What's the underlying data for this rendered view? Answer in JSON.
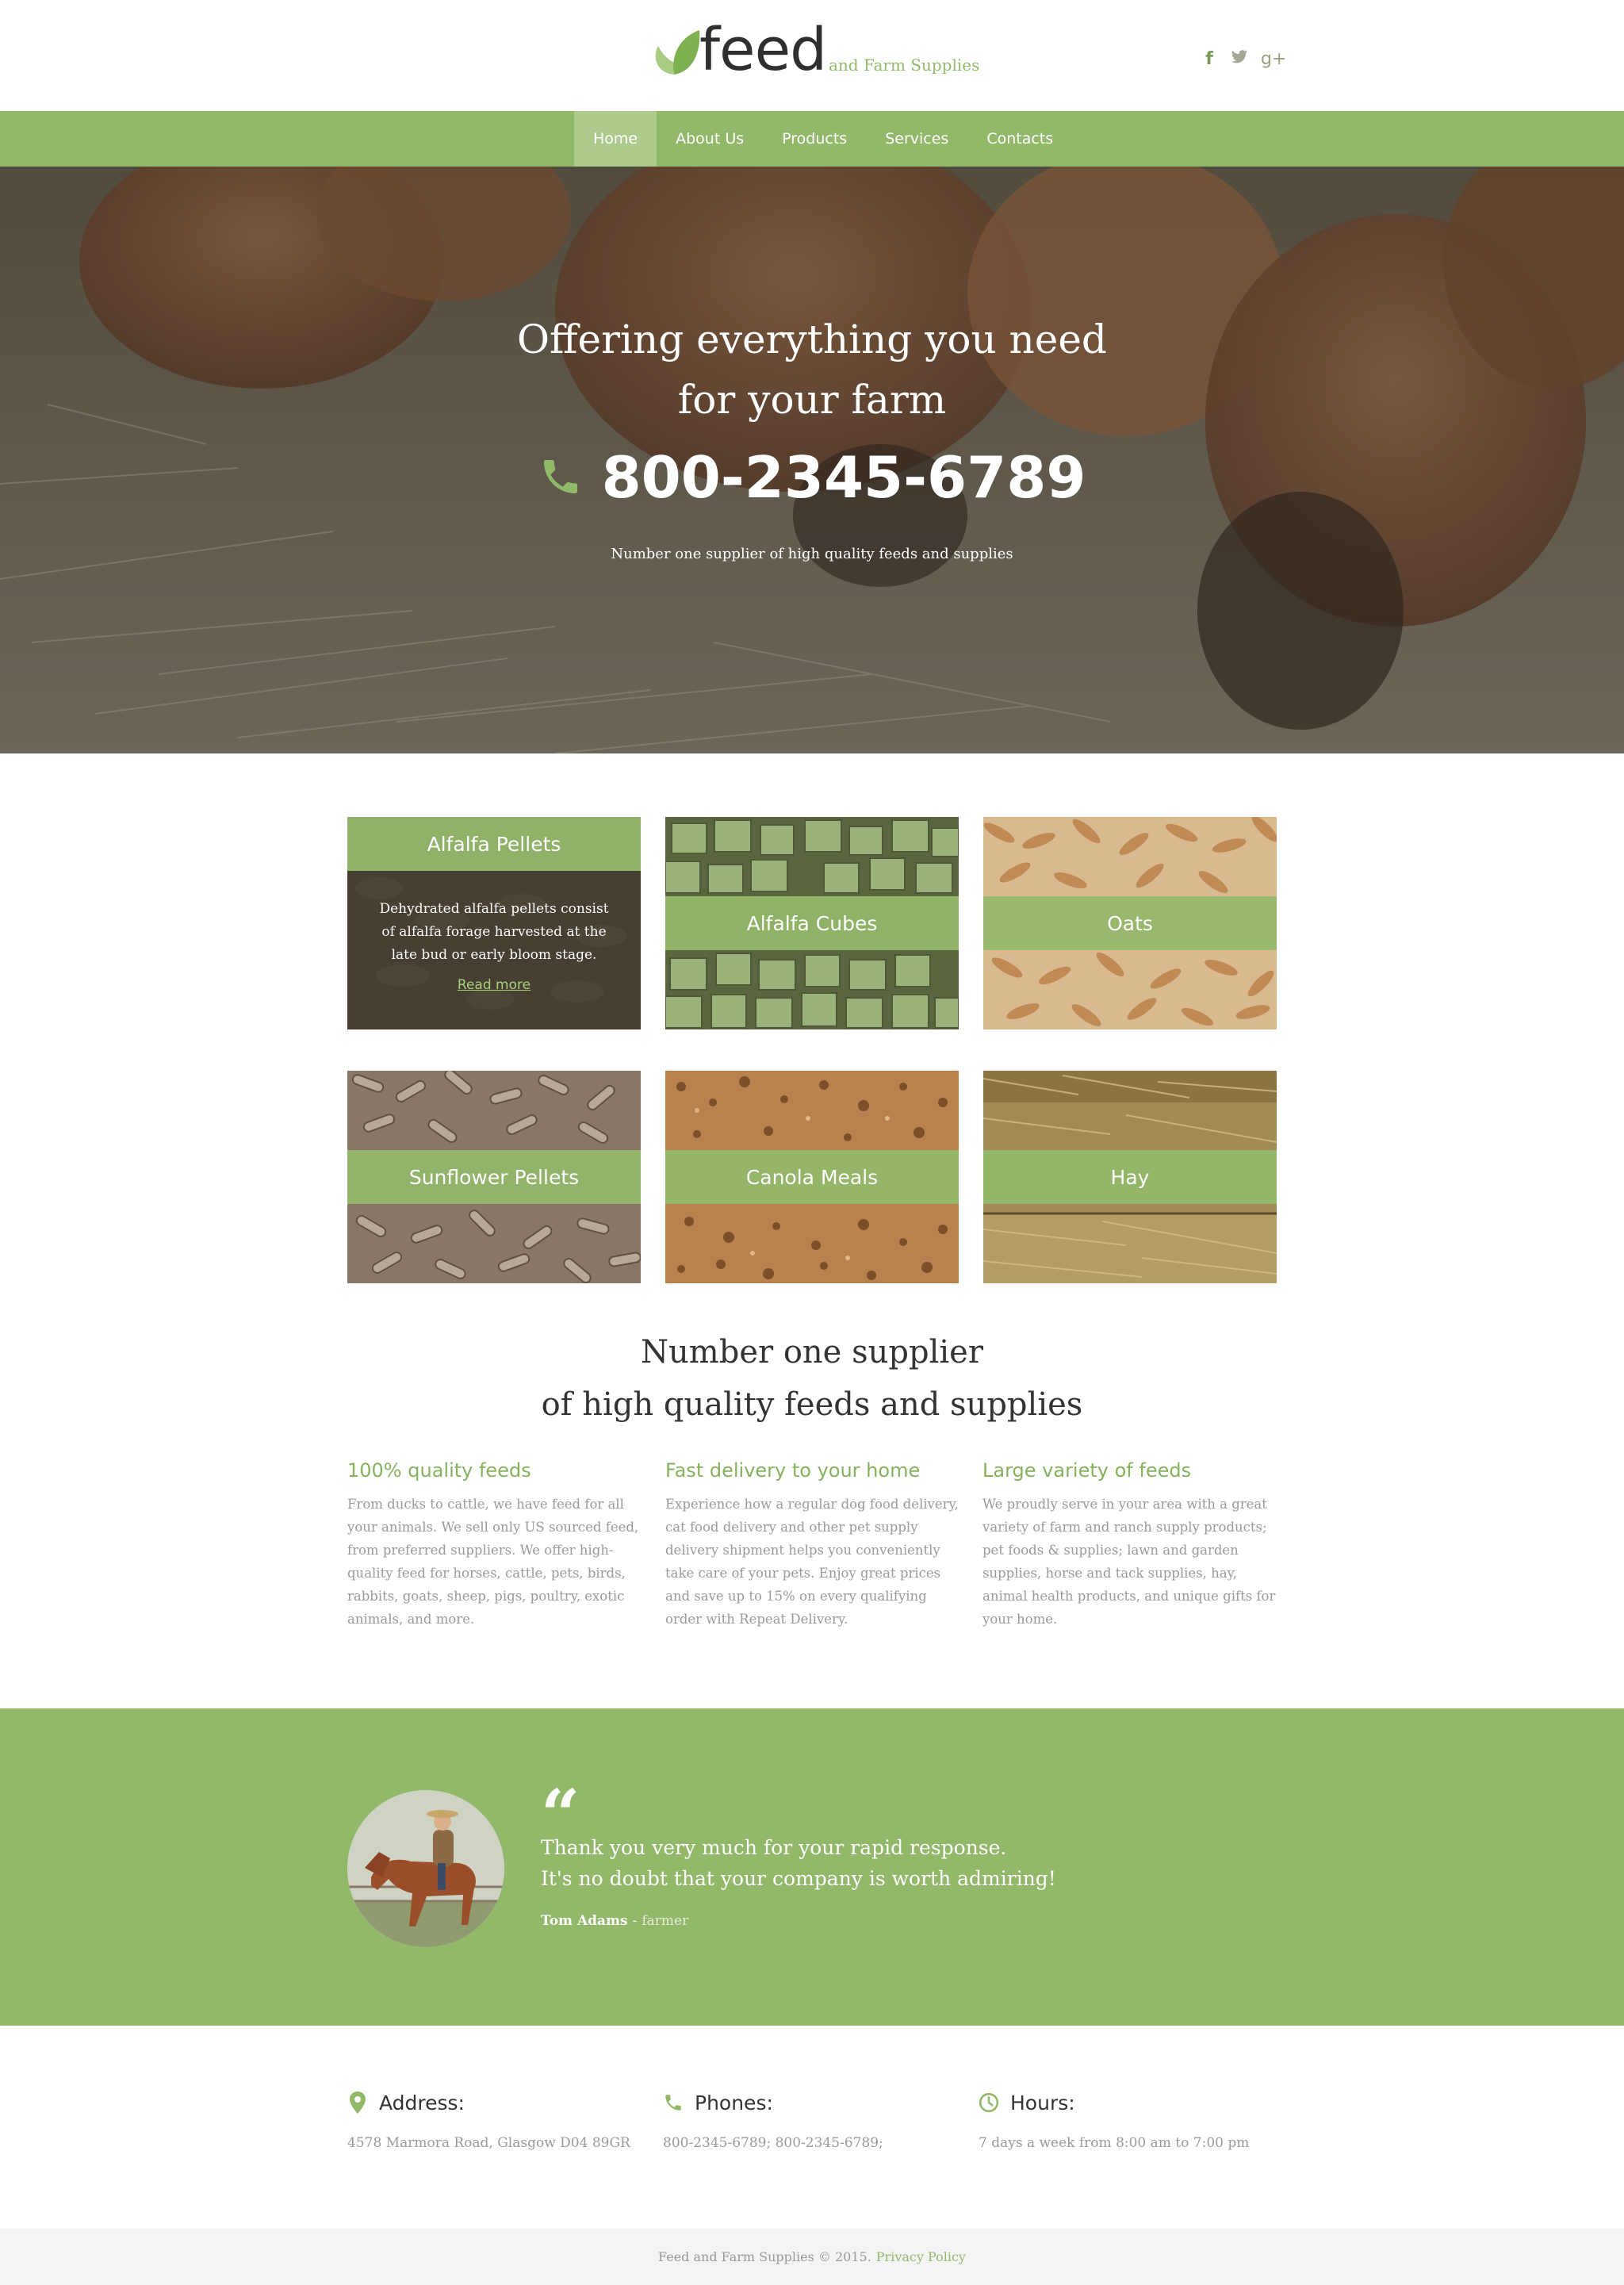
{
  "header": {
    "logo_word": "feed",
    "logo_tagline": "and Farm Supplies",
    "social": [
      {
        "icon": "facebook-icon",
        "glyph": "f"
      },
      {
        "icon": "twitter-icon",
        "glyph": "🐦"
      },
      {
        "icon": "google-plus-icon",
        "glyph": "g+"
      }
    ]
  },
  "nav": {
    "items": [
      {
        "label": "Home",
        "active": true
      },
      {
        "label": "About Us",
        "active": false
      },
      {
        "label": "Products",
        "active": false
      },
      {
        "label": "Services",
        "active": false
      },
      {
        "label": "Contacts",
        "active": false
      }
    ]
  },
  "hero": {
    "title_line1": "Offering everything you need",
    "title_line2": "for your farm",
    "phone": "800-2345-6789",
    "subtitle": "Number one supplier of high quality feeds and supplies"
  },
  "products": [
    {
      "name": "Alfalfa Pellets",
      "description": "Dehydrated alfalfa pellets consist of alfalfa forage harvested at the late bud or early bloom stage.",
      "read_more": "Read more"
    },
    {
      "name": "Alfalfa Cubes"
    },
    {
      "name": "Oats"
    },
    {
      "name": "Sunflower Pellets"
    },
    {
      "name": "Canola Meals"
    },
    {
      "name": "Hay"
    }
  ],
  "about": {
    "title_line1": "Number one supplier",
    "title_line2": "of high quality feeds and supplies",
    "features": [
      {
        "title": "100% quality feeds",
        "text": "From ducks to cattle, we have feed for all your animals. We sell only US sourced feed, from preferred suppliers. We offer high-quality feed for horses, cattle, pets, birds, rabbits, goats, sheep, pigs, poultry, exotic animals, and more."
      },
      {
        "title": "Fast delivery to your home",
        "text": "Experience how a regular dog food delivery, cat food delivery and other pet supply delivery shipment helps you conveniently take care of your pets. Enjoy great prices and save up to 15% on every qualifying order with Repeat Delivery."
      },
      {
        "title": "Large variety of feeds",
        "text": "We proudly serve in your area with a great variety of farm and ranch supply products; pet foods & supplies; lawn and garden supplies, horse and tack supplies, hay, animal health products, and unique gifts for your home."
      }
    ]
  },
  "testimonial": {
    "quote_mark": "“",
    "line1": "Thank you very much for your rapid response.",
    "line2": "It's no doubt that your company is worth admiring!",
    "author": "Tom Adams",
    "separator": "-",
    "role": "farmer"
  },
  "contacts": [
    {
      "icon": "map-pin-icon",
      "label": "Address:",
      "value": "4578 Marmora Road, Glasgow D04 89GR"
    },
    {
      "icon": "phone-icon",
      "label": "Phones:",
      "value": "800-2345-6789;  800-2345-6789;"
    },
    {
      "icon": "clock-icon",
      "label": "Hours:",
      "value": "7 days a week from 8:00 am  to  7:00 pm"
    }
  ],
  "footer": {
    "copyright": "Feed and Farm Supplies  © 2015.",
    "privacy_link": "Privacy Policy"
  },
  "colors": {
    "accent": "#92b96a",
    "accent_light": "#acca8c",
    "feature_title": "#86b25d",
    "text_gray": "#9a9a9a"
  }
}
